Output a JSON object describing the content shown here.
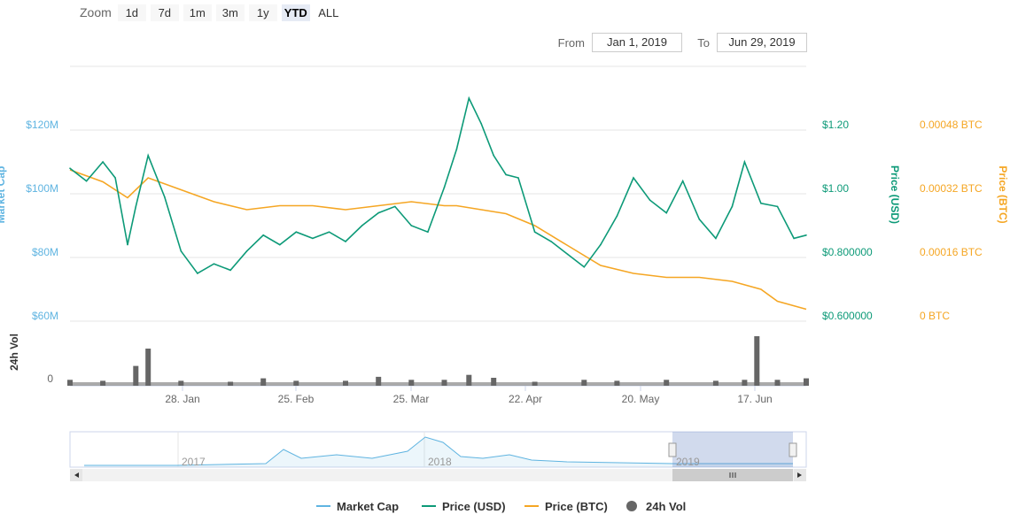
{
  "zoom": {
    "label": "Zoom",
    "buttons": [
      "1d",
      "7d",
      "1m",
      "3m",
      "1y",
      "YTD",
      "ALL"
    ],
    "active": "YTD"
  },
  "range": {
    "from_label": "From",
    "from_value": "Jan 1, 2019",
    "to_label": "To",
    "to_value": "Jun 29, 2019"
  },
  "colors": {
    "market_cap": "#5fb4e1",
    "price_usd": "#0d9a78",
    "price_btc": "#f5a623",
    "volume": "#666666",
    "grid": "#e6e6e6"
  },
  "chart_data": {
    "type": "line",
    "x_axis": {
      "ticks": [
        "28. Jan",
        "25. Feb",
        "25. Mar",
        "22. Apr",
        "20. May",
        "17. Jun"
      ]
    },
    "axes": {
      "market_cap": {
        "ylabel": "Market Cap",
        "ticks": [
          "$60M",
          "$80M",
          "$100M",
          "$120M"
        ],
        "ylim": [
          60,
          120
        ],
        "unit": "M USD"
      },
      "price_usd": {
        "ylabel": "Price (USD)",
        "ticks": [
          "$0.600000",
          "$0.800000",
          "$1.00",
          "$1.20"
        ],
        "ylim": [
          0.6,
          1.2
        ]
      },
      "price_btc": {
        "ylabel": "Price (BTC)",
        "ticks": [
          "0 BTC",
          "0.00016 BTC",
          "0.00032 BTC",
          "0.00048 BTC"
        ],
        "ylim": [
          0,
          0.00048
        ]
      },
      "volume": {
        "ylabel": "24h Vol",
        "ticks": [
          "0"
        ]
      }
    },
    "series": [
      {
        "name": "Price (USD)",
        "x": [
          "Jan 1",
          "Jan 5",
          "Jan 9",
          "Jan 12",
          "Jan 15",
          "Jan 17",
          "Jan 20",
          "Jan 24",
          "Jan 28",
          "Feb 1",
          "Feb 5",
          "Feb 9",
          "Feb 13",
          "Feb 17",
          "Feb 21",
          "Feb 25",
          "Mar 1",
          "Mar 5",
          "Mar 9",
          "Mar 13",
          "Mar 17",
          "Mar 21",
          "Mar 25",
          "Mar 29",
          "Apr 2",
          "Apr 5",
          "Apr 8",
          "Apr 11",
          "Apr 14",
          "Apr 17",
          "Apr 20",
          "Apr 24",
          "Apr 28",
          "May 2",
          "May 6",
          "May 10",
          "May 14",
          "May 18",
          "May 22",
          "May 26",
          "May 30",
          "Jun 3",
          "Jun 7",
          "Jun 11",
          "Jun 14",
          "Jun 18",
          "Jun 22",
          "Jun 26",
          "Jun 29"
        ],
        "values": [
          1.08,
          1.04,
          1.1,
          1.05,
          0.84,
          0.96,
          1.12,
          0.99,
          0.82,
          0.75,
          0.78,
          0.76,
          0.82,
          0.87,
          0.84,
          0.88,
          0.86,
          0.88,
          0.85,
          0.9,
          0.94,
          0.96,
          0.9,
          0.88,
          1.02,
          1.14,
          1.3,
          1.22,
          1.12,
          1.06,
          1.05,
          0.88,
          0.85,
          0.81,
          0.77,
          0.84,
          0.93,
          1.05,
          0.98,
          0.94,
          1.04,
          0.92,
          0.86,
          0.96,
          1.1,
          0.97,
          0.96,
          0.86,
          0.87
        ]
      },
      {
        "name": "Price (BTC)",
        "x": [
          "Jan 1",
          "Jan 9",
          "Jan 15",
          "Jan 20",
          "Jan 28",
          "Feb 5",
          "Feb 13",
          "Feb 21",
          "Mar 1",
          "Mar 9",
          "Mar 17",
          "Mar 25",
          "Apr 2",
          "Apr 5",
          "Apr 11",
          "Apr 17",
          "Apr 24",
          "May 2",
          "May 10",
          "May 18",
          "May 26",
          "Jun 3",
          "Jun 11",
          "Jun 18",
          "Jun 22",
          "Jun 29"
        ],
        "values": [
          0.00038,
          0.00035,
          0.00031,
          0.00036,
          0.00033,
          0.0003,
          0.00028,
          0.00029,
          0.00029,
          0.00028,
          0.00029,
          0.0003,
          0.00029,
          0.00029,
          0.00028,
          0.00027,
          0.00024,
          0.00019,
          0.00014,
          0.00012,
          0.00011,
          0.00011,
          0.0001,
          8e-05,
          5e-05,
          3e-05
        ]
      },
      {
        "name": "24h Vol",
        "x": [
          "Jan 1",
          "Jan 9",
          "Jan 17",
          "Jan 20",
          "Jan 28",
          "Feb 9",
          "Feb 17",
          "Feb 25",
          "Mar 9",
          "Mar 17",
          "Mar 25",
          "Apr 2",
          "Apr 8",
          "Apr 14",
          "Apr 24",
          "May 6",
          "May 14",
          "May 26",
          "Jun 7",
          "Jun 14",
          "Jun 17",
          "Jun 22",
          "Jun 29"
        ],
        "values": [
          0.12,
          0.1,
          0.4,
          0.75,
          0.1,
          0.08,
          0.15,
          0.1,
          0.1,
          0.18,
          0.12,
          0.12,
          0.22,
          0.16,
          0.08,
          0.12,
          0.1,
          0.12,
          0.1,
          0.12,
          1.0,
          0.12,
          0.15
        ]
      }
    ],
    "navigator": {
      "labels": [
        "2017",
        "2018",
        "2019"
      ]
    },
    "legend": [
      "Market Cap",
      "Price (USD)",
      "Price (BTC)",
      "24h Vol"
    ],
    "legend_position": "bottom",
    "grid": true
  }
}
